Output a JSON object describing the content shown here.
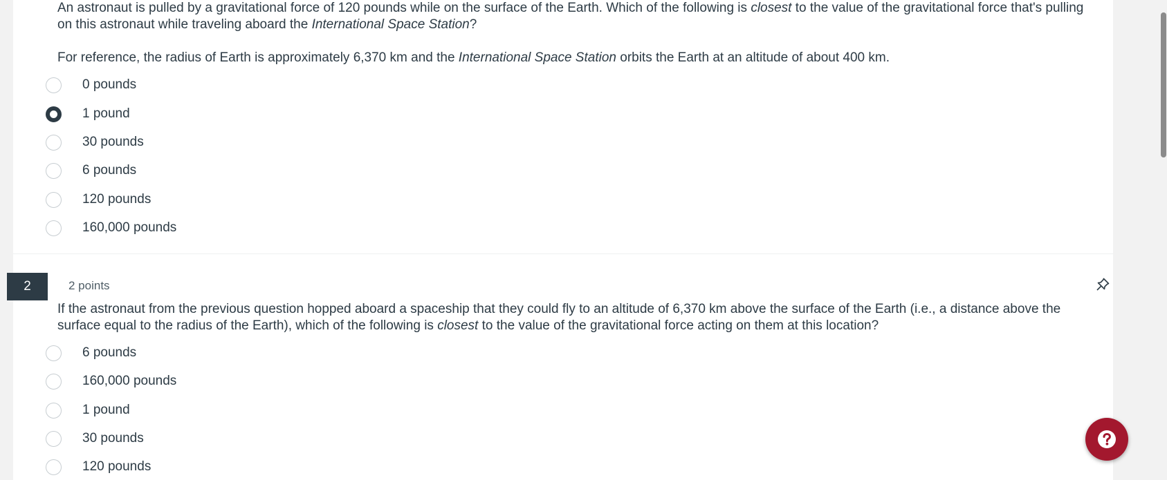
{
  "question1": {
    "text_part1": "An astronaut is pulled by a gravitational force of 120 pounds while on the surface of the Earth. Which of the following is ",
    "text_em1": "closest",
    "text_part2": " to the value of the gravitational force that's pulling on this astronaut while traveling aboard the ",
    "text_em2": "International Space Station",
    "text_part3": "?",
    "ref_part1": "For reference, the radius of Earth is approximately 6,370 km and the ",
    "ref_em": "International Space Station",
    "ref_part2": " orbits the Earth at an altitude of about 400 km.",
    "options": [
      "0 pounds",
      "1 pound",
      "30 pounds",
      "6 pounds",
      "120 pounds",
      "160,000 pounds"
    ],
    "selected": "1 pound"
  },
  "question2": {
    "number": "2",
    "points": "2 points",
    "text_part1": "If the astronaut from the previous question hopped aboard a spaceship that they could fly to an altitude of 6,370 km above the surface of the Earth (i.e., a distance above the surface equal to the radius of the Earth), which of the following is ",
    "text_em": "closest",
    "text_part2": " to the value of the gravitational force acting on them at this location?",
    "options": [
      "6 pounds",
      "160,000 pounds",
      "1 pound",
      "30 pounds",
      "120 pounds"
    ],
    "selected": null
  },
  "help": {
    "icon": "question-mark-icon",
    "color": "#a3182e"
  },
  "icons": {
    "pin": "pin-icon"
  }
}
